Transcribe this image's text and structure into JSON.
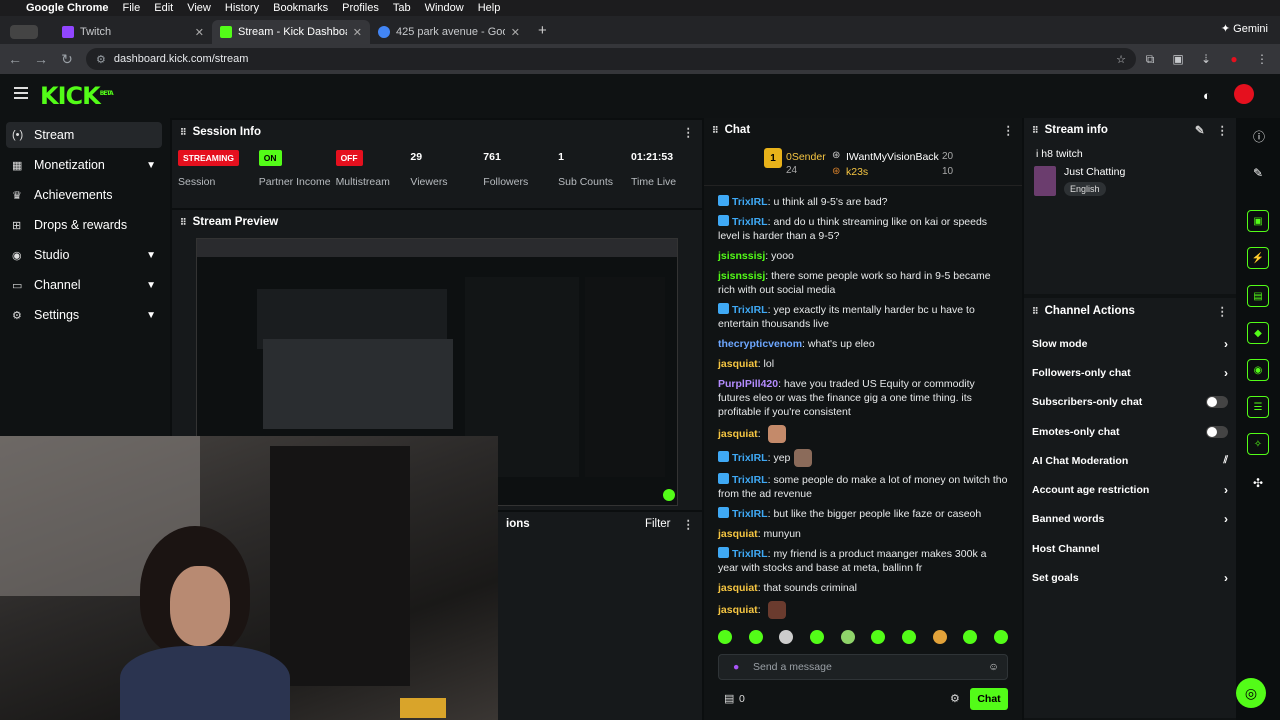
{
  "menubar": {
    "app": "Google Chrome",
    "items": [
      "File",
      "Edit",
      "View",
      "History",
      "Bookmarks",
      "Profiles",
      "Tab",
      "Window",
      "Help"
    ]
  },
  "browser": {
    "tabs": [
      {
        "title": "Twitch",
        "color": "#9146ff"
      },
      {
        "title": "Stream - Kick Dashboard",
        "color": "#53fc18"
      },
      {
        "title": "425 park avenue - Google Se",
        "color": "#4285f4"
      }
    ],
    "gemini_label": "Gemini",
    "url": "dashboard.kick.com/stream"
  },
  "app": {
    "logo": "KICK",
    "logo_super": "BETA"
  },
  "sidebar": {
    "items": [
      {
        "label": "Stream",
        "icon": "(•)"
      },
      {
        "label": "Monetization",
        "icon": "▦"
      },
      {
        "label": "Achievements",
        "icon": "♛"
      },
      {
        "label": "Drops & rewards",
        "icon": "⊞"
      },
      {
        "label": "Studio",
        "icon": "◉"
      },
      {
        "label": "Channel",
        "icon": "▭"
      },
      {
        "label": "Settings",
        "icon": "⚙"
      }
    ]
  },
  "session": {
    "title": "Session Info",
    "stats": [
      {
        "badge": "STREAMING",
        "label": "Session"
      },
      {
        "badge": "ON",
        "label": "Partner Income"
      },
      {
        "badge": "OFF",
        "label": "Multistream"
      },
      {
        "value": "29",
        "label": "Viewers"
      },
      {
        "value": "761",
        "label": "Followers"
      },
      {
        "value": "1",
        "label": "Sub Counts"
      },
      {
        "value": "01:21:53",
        "label": "Time Live"
      }
    ]
  },
  "preview": {
    "title": "Stream Preview"
  },
  "activity": {
    "partial_title": "ions",
    "filter_label": "Filter"
  },
  "chat": {
    "title": "Chat",
    "leaders": [
      {
        "rank": "1",
        "name": "0Sender",
        "amount": "24"
      },
      {
        "name": "IWantMyVisionBack",
        "amount": "20"
      },
      {
        "name": "k23s",
        "amount": "10"
      }
    ],
    "messages": [
      {
        "user": "TrixIRL",
        "kind": "trix",
        "text": "u think all 9-5's are bad?"
      },
      {
        "user": "TrixIRL",
        "kind": "trix",
        "text": "and do u think streaming like on kai or speeds level is harder than a 9-5?"
      },
      {
        "user": "jsisnssisj",
        "kind": "jsis",
        "text": "yooo"
      },
      {
        "user": "jsisnssisj",
        "kind": "jsis",
        "text": "there some people work so hard in 9-5 became rich with out social media"
      },
      {
        "user": "TrixIRL",
        "kind": "trix",
        "text": "yep exactly its mentally harder bc u have to entertain thousands live"
      },
      {
        "user": "thecrypticvenom",
        "kind": "cryp",
        "text": "what's up eleo"
      },
      {
        "user": "jasquiat",
        "kind": "jasq",
        "text": "lol"
      },
      {
        "user": "PurplPill420",
        "kind": "purp",
        "text": "have you traded US Equity or commodity futures eleo or was the finance gig a one time thing. its profitable if you're consistent"
      },
      {
        "user": "jasquiat",
        "kind": "jasq",
        "text": ""
      },
      {
        "user": "TrixIRL",
        "kind": "trix",
        "text": "yep"
      },
      {
        "user": "TrixIRL",
        "kind": "trix",
        "text": "some people do make a lot of money on twitch tho from the ad revenue"
      },
      {
        "user": "TrixIRL",
        "kind": "trix",
        "text": "but like the bigger people like faze or caseoh"
      },
      {
        "user": "jasquiat",
        "kind": "jasq",
        "text": "munyun"
      },
      {
        "user": "TrixIRL",
        "kind": "trix",
        "text": "my friend is a product maanger makes 300k a year with stocks and base at meta, ballinn fr"
      },
      {
        "user": "jasquiat",
        "kind": "jasq",
        "text": "that sounds criminal"
      },
      {
        "user": "jasquiat",
        "kind": "jasq",
        "text": ""
      }
    ],
    "placeholder": "Send a message",
    "points": "0",
    "send_label": "Chat"
  },
  "stream_info": {
    "title": "Stream info",
    "stream_title": "i h8 twitch",
    "category": "Just Chatting",
    "language": "English"
  },
  "channel_actions": {
    "title": "Channel Actions",
    "items": [
      {
        "label": "Slow mode",
        "control": "arrow"
      },
      {
        "label": "Followers-only chat",
        "control": "arrow"
      },
      {
        "label": "Subscribers-only chat",
        "control": "toggle"
      },
      {
        "label": "Emotes-only chat",
        "control": "toggle"
      },
      {
        "label": "AI Chat Moderation",
        "control": "chart"
      },
      {
        "label": "Account age restriction",
        "control": "arrow"
      },
      {
        "label": "Banned words",
        "control": "arrow"
      },
      {
        "label": "Host Channel",
        "control": "none"
      },
      {
        "label": "Set goals",
        "control": "arrow"
      }
    ]
  },
  "colors": {
    "accent": "#53fc18",
    "danger": "#e5101e"
  }
}
